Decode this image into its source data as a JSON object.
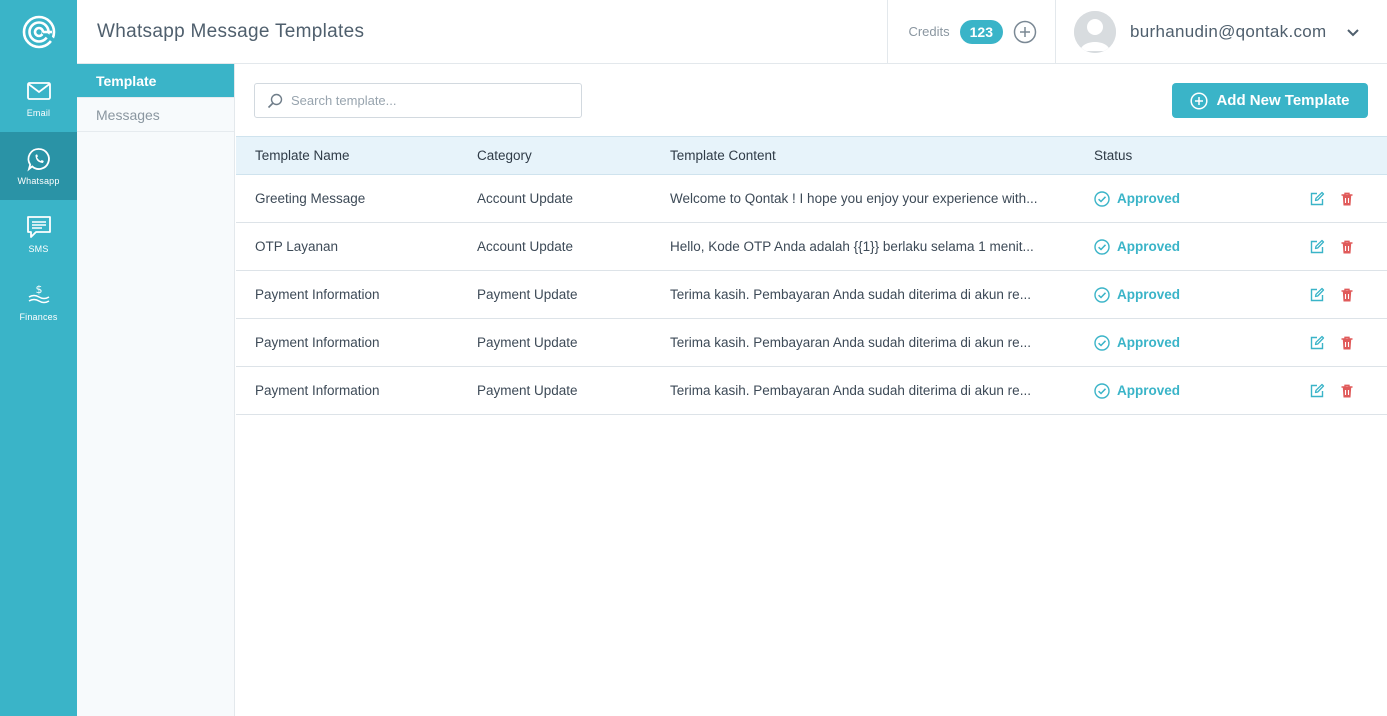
{
  "colors": {
    "accent": "#3ab4c8",
    "accent_dark": "#2a93a6",
    "danger": "#e05a5a"
  },
  "rail": {
    "logo_icon": "qontak-logo-icon",
    "items": [
      {
        "label": "Email",
        "icon": "envelope-icon"
      },
      {
        "label": "Whatsapp",
        "icon": "whatsapp-icon"
      },
      {
        "label": "SMS",
        "icon": "sms-icon"
      },
      {
        "label": "Finances",
        "icon": "finances-icon"
      }
    ]
  },
  "header": {
    "title": "Whatsapp Message Templates",
    "credits_label": "Credits",
    "credits_value": "123",
    "user_email": "burhanudin@qontak.com"
  },
  "subnav": {
    "items": [
      {
        "label": "Template"
      },
      {
        "label": "Messages"
      }
    ]
  },
  "toolbar": {
    "search_placeholder": "Search template...",
    "add_button": "Add New Template"
  },
  "table": {
    "headers": {
      "name": "Template Name",
      "category": "Category",
      "content": "Template Content",
      "status": "Status"
    },
    "rows": [
      {
        "name": "Greeting Message",
        "category": "Account Update",
        "content": "Welcome to Qontak ! I hope you enjoy your experience with...",
        "status": "Approved"
      },
      {
        "name": "OTP Layanan",
        "category": "Account Update",
        "content": "Hello, Kode OTP Anda adalah {{1}} berlaku selama 1 menit...",
        "status": "Approved"
      },
      {
        "name": "Payment Information",
        "category": "Payment Update",
        "content": "Terima kasih. Pembayaran Anda sudah diterima di akun re...",
        "status": "Approved"
      },
      {
        "name": "Payment Information",
        "category": "Payment Update",
        "content": "Terima kasih. Pembayaran Anda sudah diterima di akun re...",
        "status": "Approved"
      },
      {
        "name": "Payment Information",
        "category": "Payment Update",
        "content": "Terima kasih. Pembayaran Anda sudah diterima di akun re...",
        "status": "Approved"
      }
    ]
  }
}
